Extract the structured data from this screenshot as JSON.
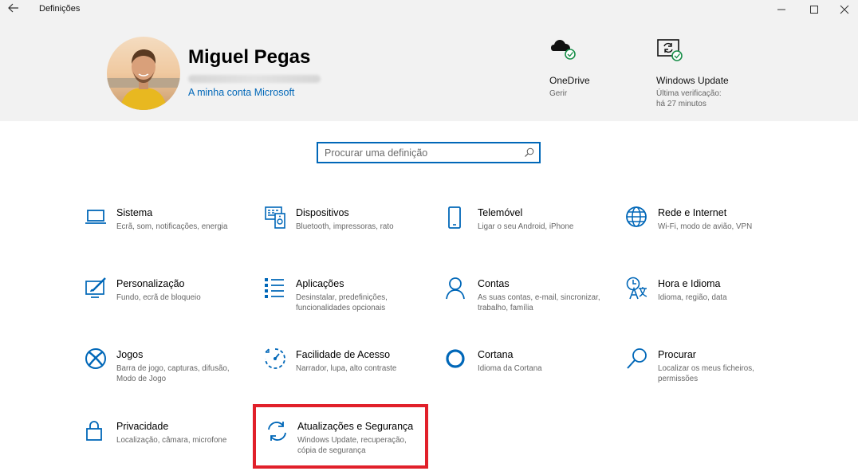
{
  "window": {
    "title": "Definições"
  },
  "account": {
    "name": "Miguel Pegas",
    "link": "A minha conta Microsoft"
  },
  "quick_actions": [
    {
      "title": "OneDrive",
      "sub1": "Gerir",
      "sub2": ""
    },
    {
      "title": "Windows Update",
      "sub1": "Última verificação:",
      "sub2": "há 27 minutos"
    }
  ],
  "search": {
    "placeholder": "Procurar uma definição"
  },
  "categories": [
    {
      "title": "Sistema",
      "desc": "Ecrã, som, notificações, energia",
      "icon": "laptop-icon"
    },
    {
      "title": "Dispositivos",
      "desc": "Bluetooth, impressoras, rato",
      "icon": "devices-icon"
    },
    {
      "title": "Telemóvel",
      "desc": "Ligar o seu Android, iPhone",
      "icon": "phone-icon"
    },
    {
      "title": "Rede e Internet",
      "desc": "Wi-Fi, modo de avião, VPN",
      "icon": "globe-icon"
    },
    {
      "title": "Personalização",
      "desc": "Fundo, ecrã de bloqueio",
      "icon": "paint-icon"
    },
    {
      "title": "Aplicações",
      "desc": "Desinstalar, predefinições, funcionalidades opcionais",
      "icon": "apps-list-icon"
    },
    {
      "title": "Contas",
      "desc": "As suas contas, e-mail, sincronizar, trabalho, família",
      "icon": "person-icon"
    },
    {
      "title": "Hora e Idioma",
      "desc": "Idioma, região, data",
      "icon": "time-language-icon"
    },
    {
      "title": "Jogos",
      "desc": "Barra de jogo, capturas, difusão, Modo de Jogo",
      "icon": "xbox-icon"
    },
    {
      "title": "Facilidade de Acesso",
      "desc": "Narrador, lupa, alto contraste",
      "icon": "ease-of-access-icon"
    },
    {
      "title": "Cortana",
      "desc": "Idioma da Cortana",
      "icon": "cortana-icon"
    },
    {
      "title": "Procurar",
      "desc": "Localizar os meus ficheiros, permissões",
      "icon": "search-icon"
    },
    {
      "title": "Privacidade",
      "desc": "Localização, câmara, microfone",
      "icon": "lock-icon"
    },
    {
      "title": "Atualizações e Segurança",
      "desc": "Windows Update, recuperação, cópia de segurança",
      "icon": "update-sync-icon"
    }
  ],
  "colors": {
    "accent": "#0067b8",
    "highlight": "#e1202a",
    "header_bg": "#f2f2f2"
  }
}
